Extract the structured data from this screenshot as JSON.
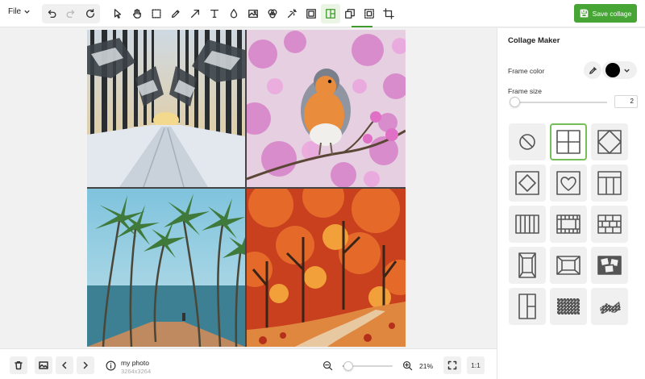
{
  "toolbar": {
    "file_label": "File",
    "save_label": "Save collage",
    "tools": [
      {
        "icon": "undo-icon"
      },
      {
        "icon": "redo-icon"
      },
      {
        "icon": "reset-icon"
      },
      {
        "icon": "pointer-icon"
      },
      {
        "icon": "hand-icon"
      },
      {
        "icon": "select-icon"
      },
      {
        "icon": "pencil-icon"
      },
      {
        "icon": "arrow-icon"
      },
      {
        "icon": "text-icon"
      },
      {
        "icon": "drop-icon"
      },
      {
        "icon": "image-adjust-icon"
      },
      {
        "icon": "filter-icon"
      },
      {
        "icon": "magic-wand-icon"
      },
      {
        "icon": "frame-icon"
      },
      {
        "icon": "collage-icon"
      },
      {
        "icon": "layers-icon"
      },
      {
        "icon": "resize-icon"
      },
      {
        "icon": "crop-icon"
      }
    ],
    "active_tool": "collage-icon"
  },
  "panel": {
    "title": "Collage Maker",
    "frame_color_label": "Frame color",
    "frame_color": "#000000",
    "frame_size_label": "Frame size",
    "frame_size_value": "2",
    "frame_size_fraction": 0.03,
    "layouts": [
      "no-frame",
      "grid-2x2",
      "diamond",
      "diamond-in-square",
      "heart",
      "header-columns",
      "vertical-stripes",
      "brick-grid",
      "brick-wall",
      "portrait-frames",
      "center-frame",
      "scattered-photos",
      "split-vertical",
      "checker-fade",
      "checker-scatter"
    ],
    "selected_layout": "grid-2x2"
  },
  "bottom": {
    "photo_name": "my photo",
    "photo_size": "3264x3264",
    "zoom_value": "21%",
    "zoom_fraction": 0.12,
    "one_to_one_label": "1:1"
  },
  "collage": {
    "cells": [
      {
        "scene": "snowy-forest-road"
      },
      {
        "scene": "robin-on-blossom-branch"
      },
      {
        "scene": "palm-trees-beach"
      },
      {
        "scene": "autumn-forest-path"
      }
    ]
  },
  "colors": {
    "accent": "#47a536",
    "selected_border": "#74bf58"
  }
}
